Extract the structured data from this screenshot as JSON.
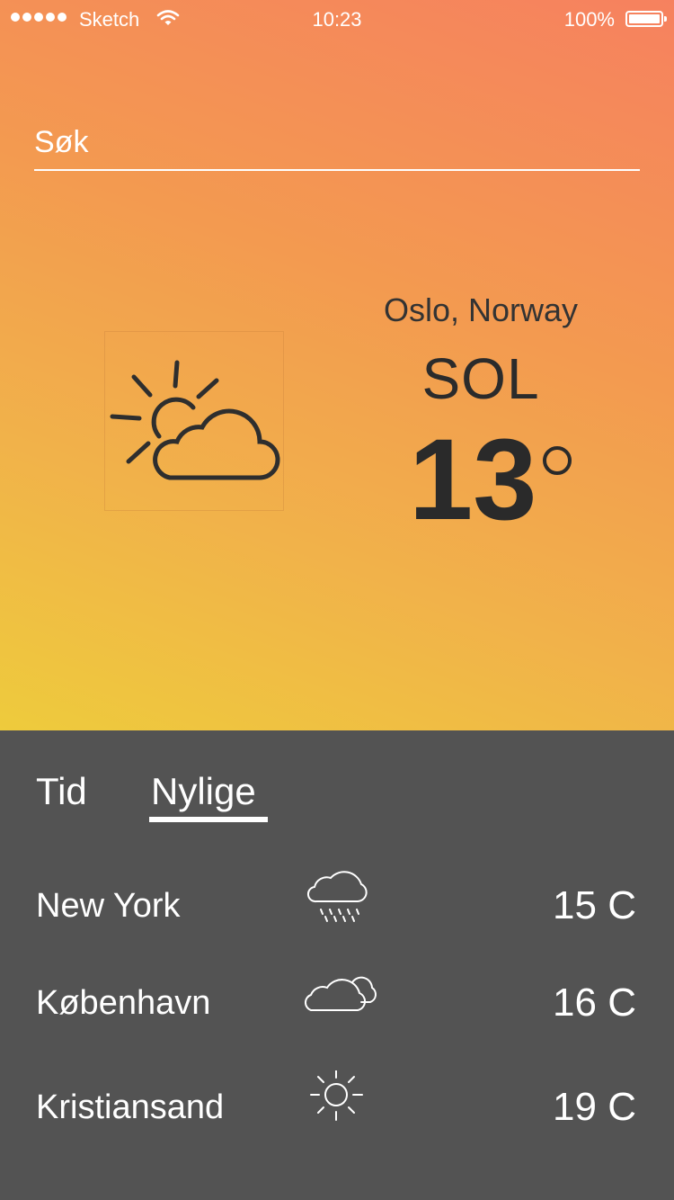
{
  "status_bar": {
    "carrier": "Sketch",
    "time": "10:23",
    "battery": "100%"
  },
  "search": {
    "placeholder": "Søk"
  },
  "current": {
    "location": "Oslo, Norway",
    "condition": "SOL",
    "temperature": "13",
    "icon": "partly-cloudy-icon"
  },
  "tabs": [
    {
      "label": "Tid",
      "active": false
    },
    {
      "label": "Nylige",
      "active": true
    }
  ],
  "recent": [
    {
      "city": "New York",
      "temp": "15 C",
      "icon": "rain-cloud-icon"
    },
    {
      "city": "København",
      "temp": "16 C",
      "icon": "clouds-icon"
    },
    {
      "city": "Kristiansand",
      "temp": "19 C",
      "icon": "sun-icon"
    }
  ],
  "colors": {
    "gradient_top": "#f6815f",
    "gradient_bottom": "#eecb3c",
    "panel": "#535353"
  }
}
